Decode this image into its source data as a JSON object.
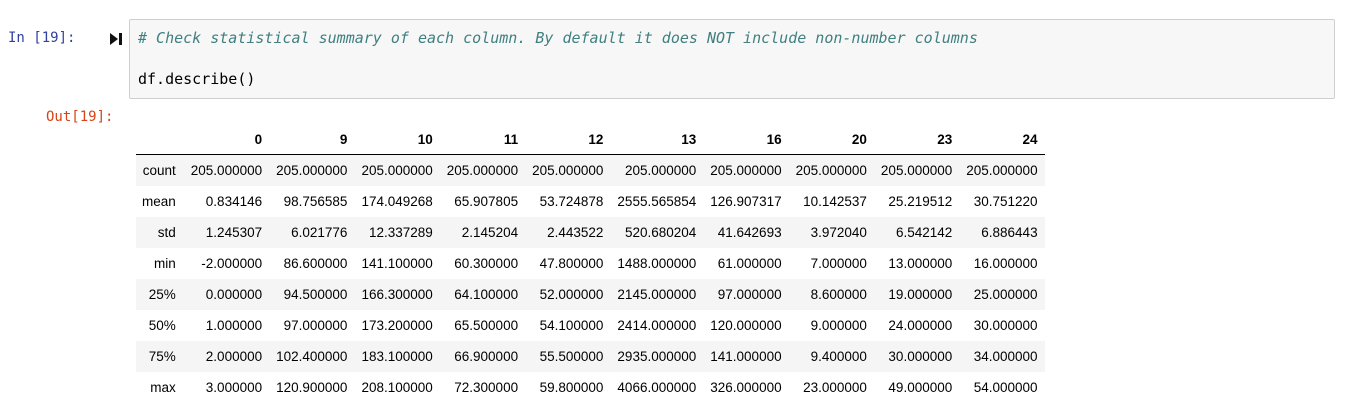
{
  "input_prompt": "In [19]:",
  "output_prompt": "Out[19]:",
  "code": {
    "comment": "# Check statistical summary of each column. By default it does NOT include non-number columns",
    "call": "df.describe()"
  },
  "table": {
    "columns": [
      "0",
      "9",
      "10",
      "11",
      "12",
      "13",
      "16",
      "20",
      "23",
      "24"
    ],
    "rows": [
      {
        "label": "count",
        "values": [
          "205.000000",
          "205.000000",
          "205.000000",
          "205.000000",
          "205.000000",
          "205.000000",
          "205.000000",
          "205.000000",
          "205.000000",
          "205.000000"
        ]
      },
      {
        "label": "mean",
        "values": [
          "0.834146",
          "98.756585",
          "174.049268",
          "65.907805",
          "53.724878",
          "2555.565854",
          "126.907317",
          "10.142537",
          "25.219512",
          "30.751220"
        ]
      },
      {
        "label": "std",
        "values": [
          "1.245307",
          "6.021776",
          "12.337289",
          "2.145204",
          "2.443522",
          "520.680204",
          "41.642693",
          "3.972040",
          "6.542142",
          "6.886443"
        ]
      },
      {
        "label": "min",
        "values": [
          "-2.000000",
          "86.600000",
          "141.100000",
          "60.300000",
          "47.800000",
          "1488.000000",
          "61.000000",
          "7.000000",
          "13.000000",
          "16.000000"
        ]
      },
      {
        "label": "25%",
        "values": [
          "0.000000",
          "94.500000",
          "166.300000",
          "64.100000",
          "52.000000",
          "2145.000000",
          "97.000000",
          "8.600000",
          "19.000000",
          "25.000000"
        ]
      },
      {
        "label": "50%",
        "values": [
          "1.000000",
          "97.000000",
          "173.200000",
          "65.500000",
          "54.100000",
          "2414.000000",
          "120.000000",
          "9.000000",
          "24.000000",
          "30.000000"
        ]
      },
      {
        "label": "75%",
        "values": [
          "2.000000",
          "102.400000",
          "183.100000",
          "66.900000",
          "55.500000",
          "2935.000000",
          "141.000000",
          "9.400000",
          "30.000000",
          "34.000000"
        ]
      },
      {
        "label": "max",
        "values": [
          "3.000000",
          "120.900000",
          "208.100000",
          "72.300000",
          "59.800000",
          "4066.000000",
          "326.000000",
          "23.000000",
          "49.000000",
          "54.000000"
        ]
      }
    ]
  },
  "colors": {
    "input_prompt": "#303f9f",
    "output_prompt": "#d84315",
    "comment": "#408080",
    "cell_background": "#f7f7f7"
  },
  "icons": {
    "run_indicator": "run-cell-icon"
  }
}
